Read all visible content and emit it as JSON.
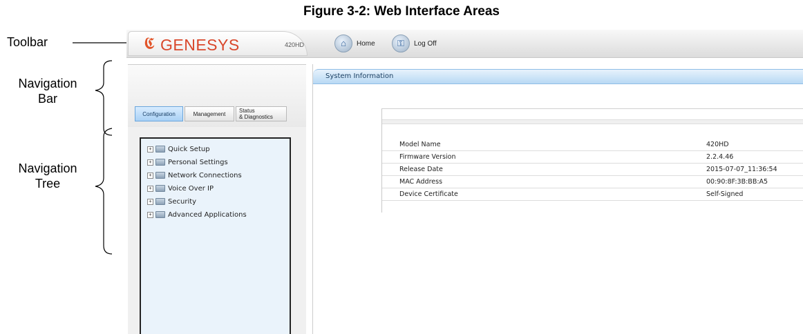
{
  "figure": {
    "caption": "Figure 3-2: Web Interface Areas"
  },
  "annotations": {
    "toolbar": "Toolbar",
    "navigation_bar": [
      "Navigation",
      "Bar"
    ],
    "navigation_tree": [
      "Navigation",
      "Tree"
    ]
  },
  "toolbar": {
    "brand": "GENESYS",
    "model": "420HD",
    "home_label": "Home",
    "logoff_label": "Log Off"
  },
  "nav_tabs": {
    "configuration": "Configuration",
    "management": "Management",
    "status_line1": "Status",
    "status_line2": "& Diagnostics"
  },
  "tree": {
    "items": [
      "Quick Setup",
      "Personal Settings",
      "Network Connections",
      "Voice Over IP",
      "Security",
      "Advanced Applications"
    ]
  },
  "content": {
    "title": "System Information",
    "rows": [
      {
        "label": "Model Name",
        "value": "420HD"
      },
      {
        "label": "Firmware Version",
        "value": "2.2.4.46"
      },
      {
        "label": "Release Date",
        "value": "2015-07-07_11:36:54"
      },
      {
        "label": "MAC Address",
        "value": "00:90:8F:3B:BB:A5"
      },
      {
        "label": "Device Certificate",
        "value": "Self-Signed"
      }
    ]
  },
  "colors": {
    "brand": "#d9472b",
    "selected_tab": "#a9d1f5",
    "header_bar": "#b8d9f4"
  }
}
